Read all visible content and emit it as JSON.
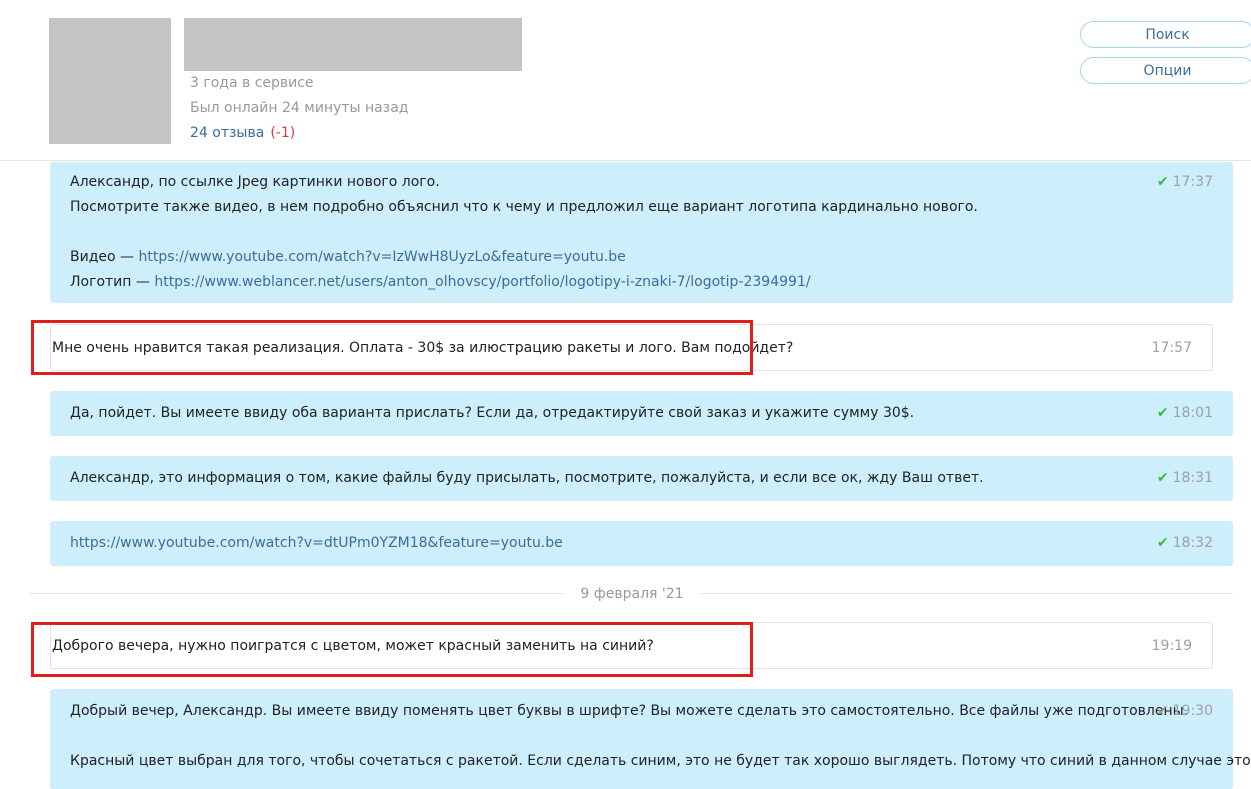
{
  "profile": {
    "service_years": "3 года в сервисе",
    "last_online": "Был онлайн 24 минуты назад",
    "reviews": "24 отзыва",
    "negative": "(-1)"
  },
  "buttons": {
    "search": "Поиск",
    "options": "Опции"
  },
  "messages": [
    {
      "lines": [
        "Александр, по ссылке Jpeg картинки нового лого.",
        "Посмотрите также видео, в нем подробно объяснил что к чему и предложил еще вариант логотипа кардинально нового."
      ],
      "video_label": "Видео — ",
      "video_link": "https://www.youtube.com/watch?v=IzWwH8UyzLo&feature=youtu.be",
      "logo_label": "Логотип — ",
      "logo_link": "https://www.weblancer.net/users/anton_olhovscy/portfolio/logotipy-i-znaki-7/logotip-2394991/",
      "time": "17:37"
    },
    {
      "text": "Мне очень нравится такая реализация. Оплата - 30$ за илюстрацию ракеты и лого. Вам подойдет?",
      "time": "17:57"
    },
    {
      "text": "Да, пойдет. Вы имеете ввиду оба варианта прислать? Если да, отредактируйте свой заказ и укажите сумму 30$.",
      "time": "18:01"
    },
    {
      "text": "Александр, это информация о том, какие файлы буду присылать, посмотрите, пожалуйста, и если все ок, жду Ваш ответ.",
      "time": "18:31"
    },
    {
      "link": "https://www.youtube.com/watch?v=dtUPm0YZM18&feature=youtu.be",
      "time": "18:32"
    },
    {
      "text": "Доброго вечера, нужно поигратся с цветом, может красный заменить на синий?",
      "time": "19:19"
    },
    {
      "line1": "Добрый вечер, Александр. Вы имеете ввиду поменять цвет буквы в шрифте? Вы можете сделать это самостоятельно. Все файлы уже подготовлены.",
      "line2": "Красный цвет выбран для того, чтобы сочетаться с ракетой. Если сделать синим, это не будет так хорошо выглядеть. Потому что синий в данном случае это",
      "time": "19:30"
    }
  ],
  "date_divider": "9 февраля '21",
  "colors": {
    "my_bubble": "#cdeefb",
    "highlight": "#e01e1e",
    "link": "#3a6e99",
    "check": "#3fb84a"
  }
}
